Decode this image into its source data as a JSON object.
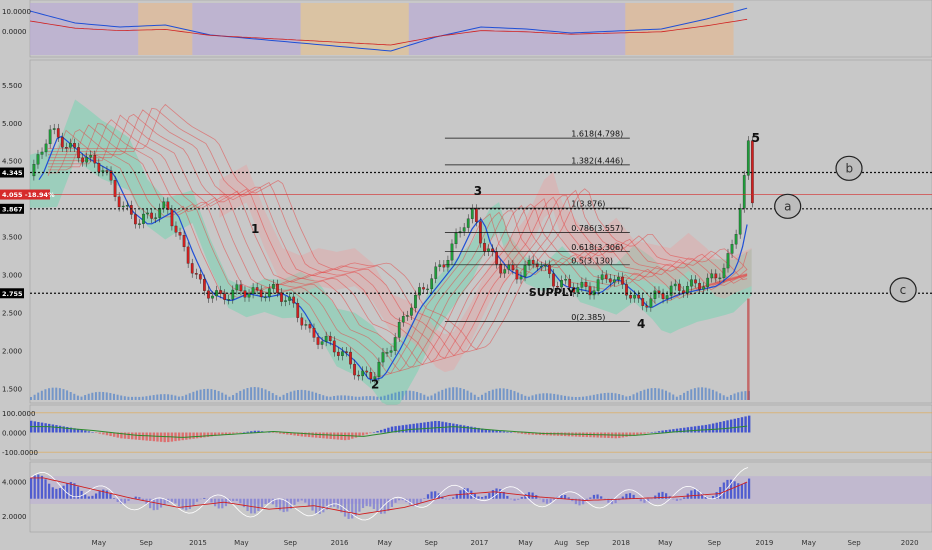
{
  "chart_data": {
    "type": "line",
    "colors": {
      "background": "#c8c8c8",
      "cloud_green": "#6fd3b0",
      "cloud_red": "#e9a0a0",
      "candle_up": "#1f9d3a",
      "candle_down": "#d02020",
      "ma_fast": "#1f4fd6",
      "ribbon": "#e64545",
      "price_badge": "#d62b2b",
      "volume": "#2f6ec8"
    },
    "main_pane": {
      "y_ticks": [
        "5.500",
        "5.000",
        "4.500",
        "3.500",
        "3.000",
        "2.500",
        "2.000",
        "1.500"
      ],
      "y_tick_values": [
        5.5,
        5.0,
        4.5,
        3.5,
        3.0,
        2.5,
        2.0,
        1.5
      ],
      "ylim": [
        1.35,
        5.8
      ],
      "price_badges": [
        {
          "label": "4.345",
          "value": 4.345,
          "color": "#000000"
        },
        {
          "label": "4.055",
          "pct": "-18.94%",
          "value": 4.055,
          "color": "#d62b2b"
        },
        {
          "label": "3.867",
          "value": 3.867,
          "color": "#000000"
        },
        {
          "label": "2.755",
          "value": 2.755,
          "color": "#000000"
        }
      ],
      "dotted_levels": [
        4.345,
        3.867,
        2.755
      ],
      "fib_levels": [
        {
          "label": "1.618(4.798)",
          "value": 4.798
        },
        {
          "label": "1.382(4.446)",
          "value": 4.446
        },
        {
          "label": "1(3.876)",
          "value": 3.876
        },
        {
          "label": "0.786(3.557)",
          "value": 3.557
        },
        {
          "label": "0.618(3.306)",
          "value": 3.306
        },
        {
          "label": "0.5(3.130)",
          "value": 3.13
        },
        {
          "label": "0(2.385)",
          "value": 2.385
        }
      ],
      "annotations": [
        "SUPPLY"
      ],
      "wave_labels": [
        {
          "text": "1",
          "t": 0.245,
          "price": 3.55
        },
        {
          "text": "2",
          "t": 0.378,
          "price": 1.5
        },
        {
          "text": "3",
          "t": 0.492,
          "price": 4.05
        },
        {
          "text": "4",
          "t": 0.673,
          "price": 2.3
        },
        {
          "text": "5",
          "t": 0.8,
          "price": 4.75
        }
      ],
      "circle_labels": [
        {
          "text": "b",
          "price": 4.4
        },
        {
          "text": "a",
          "price": 3.9
        },
        {
          "text": "c",
          "price": 2.8
        }
      ],
      "price_series": {
        "t": [
          0.0,
          0.02,
          0.05,
          0.08,
          0.1,
          0.12,
          0.15,
          0.17,
          0.19,
          0.21,
          0.23,
          0.25,
          0.27,
          0.29,
          0.31,
          0.33,
          0.35,
          0.365,
          0.38,
          0.4,
          0.42,
          0.44,
          0.46,
          0.48,
          0.49,
          0.5,
          0.52,
          0.54,
          0.56,
          0.58,
          0.6,
          0.62,
          0.64,
          0.66,
          0.675,
          0.69,
          0.71,
          0.73,
          0.75,
          0.77,
          0.78,
          0.79,
          0.795,
          0.8
        ],
        "price": [
          4.3,
          4.9,
          4.6,
          4.4,
          3.9,
          3.7,
          3.9,
          3.3,
          2.8,
          2.7,
          2.8,
          2.75,
          2.8,
          2.6,
          2.2,
          2.1,
          1.9,
          1.65,
          1.7,
          2.1,
          2.6,
          2.9,
          3.2,
          3.7,
          3.8,
          3.4,
          3.1,
          3.0,
          3.2,
          2.9,
          2.85,
          2.8,
          3.0,
          2.8,
          2.6,
          2.7,
          2.8,
          2.85,
          2.9,
          3.1,
          3.5,
          4.2,
          4.7,
          3.9
        ]
      },
      "volume_spike": {
        "t": 0.795,
        "fraction": 0.75
      }
    },
    "top_pane": {
      "y_ticks": [
        "10.0000",
        "0.0000"
      ],
      "y_tick_values": [
        10,
        0
      ],
      "ylim": [
        -12,
        14
      ],
      "series": {
        "t": [
          0.0,
          0.05,
          0.1,
          0.15,
          0.2,
          0.25,
          0.3,
          0.35,
          0.4,
          0.45,
          0.5,
          0.55,
          0.6,
          0.65,
          0.7,
          0.75,
          0.8
        ],
        "values": [
          10,
          4,
          2,
          3,
          -2,
          -4,
          -6,
          -8,
          -10,
          -3,
          2,
          1,
          -1,
          0,
          1,
          6,
          12
        ]
      }
    },
    "macd_pane": {
      "y_ticks": [
        "100.0000",
        "0.0000",
        "-100.0000"
      ],
      "y_tick_values": [
        100,
        0,
        -100
      ],
      "ylim": [
        -130,
        130
      ],
      "histogram": {
        "t": [
          0.0,
          0.05,
          0.1,
          0.15,
          0.2,
          0.25,
          0.3,
          0.35,
          0.4,
          0.45,
          0.5,
          0.55,
          0.6,
          0.65,
          0.7,
          0.75,
          0.8
        ],
        "values": [
          60,
          20,
          -30,
          -50,
          -20,
          10,
          -20,
          -40,
          30,
          60,
          20,
          -10,
          -20,
          -30,
          10,
          40,
          90
        ]
      }
    },
    "rsi_pane": {
      "y_ticks": [
        "4.0000",
        "2.0000"
      ],
      "y_tick_values": [
        4,
        2
      ],
      "ylim": [
        1.2,
        5.0
      ],
      "series": {
        "t": [
          0.0,
          0.05,
          0.1,
          0.15,
          0.2,
          0.25,
          0.3,
          0.35,
          0.4,
          0.45,
          0.5,
          0.55,
          0.6,
          0.65,
          0.7,
          0.75,
          0.8
        ],
        "values": [
          4.2,
          3.6,
          3.0,
          2.5,
          2.8,
          2.4,
          2.6,
          2.1,
          2.5,
          3.2,
          3.4,
          3.1,
          2.9,
          3.0,
          3.1,
          3.3,
          4.4
        ]
      }
    },
    "x_ticks": [
      "May",
      "Sep",
      "2015",
      "May",
      "Sep",
      "2016",
      "May",
      "Sep",
      "2017",
      "May",
      "Aug",
      "Sep",
      "2018",
      "May",
      "Sep",
      "2019",
      "May",
      "Sep",
      "2020"
    ],
    "x_tick_positions": [
      0.075,
      0.128,
      0.183,
      0.233,
      0.288,
      0.34,
      0.392,
      0.444,
      0.495,
      0.548,
      0.588,
      0.612,
      0.652,
      0.703,
      0.758,
      0.811,
      0.862,
      0.913,
      0.972
    ]
  }
}
